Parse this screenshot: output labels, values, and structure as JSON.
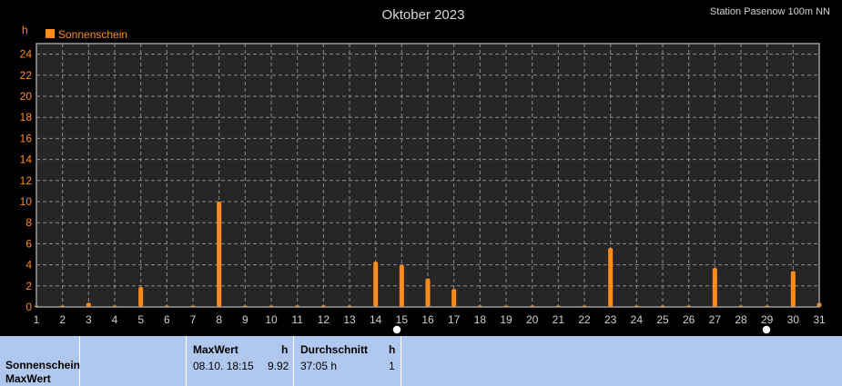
{
  "header": {
    "title": "Oktober 2023",
    "station": "Station Pasenow  100m NN",
    "unit": "h"
  },
  "colors": {
    "background": "#000000",
    "plot_background": "#262626",
    "bar": "#ff8c1a",
    "table_background": "#b0c8ee"
  },
  "chart_data": {
    "type": "bar",
    "title": "Oktober 2023",
    "ylabel": "h",
    "xlabel": "",
    "ylim": [
      0,
      25
    ],
    "xlim": [
      1,
      31
    ],
    "y_ticks": [
      0,
      2,
      4,
      6,
      8,
      10,
      12,
      14,
      16,
      18,
      20,
      22,
      24
    ],
    "x_ticks": [
      1,
      2,
      3,
      4,
      5,
      6,
      7,
      8,
      9,
      10,
      11,
      12,
      13,
      14,
      15,
      16,
      17,
      18,
      19,
      20,
      21,
      22,
      23,
      24,
      25,
      26,
      27,
      28,
      29,
      30,
      31
    ],
    "grid": true,
    "legend_position": "top-left",
    "series": [
      {
        "name": "Sonnenschein",
        "x": [
          1,
          2,
          3,
          4,
          5,
          6,
          7,
          8,
          9,
          10,
          11,
          12,
          13,
          14,
          15,
          16,
          17,
          18,
          19,
          20,
          21,
          22,
          23,
          24,
          25,
          26,
          27,
          28,
          29,
          30,
          31
        ],
        "values": [
          0,
          0,
          0.4,
          0,
          1.9,
          0,
          0,
          10.0,
          0,
          0,
          0.15,
          0.15,
          0.05,
          4.3,
          4.0,
          2.7,
          1.7,
          0.05,
          0.05,
          0.05,
          0.05,
          0.05,
          5.6,
          0.05,
          0.05,
          0.05,
          3.7,
          0.05,
          0,
          3.4,
          0.4
        ]
      }
    ]
  },
  "table": {
    "row_label_1": "Sonnenschein",
    "row_label_2": "MaxWert",
    "maxwert_header": "MaxWert",
    "maxwert_unit": "h",
    "maxwert_date": "08.10.  18:15",
    "maxwert_value": "9.92",
    "avg_header": "Durchschnitt",
    "avg_unit": "h",
    "avg_value": "37:05 h",
    "avg_count": "1"
  }
}
